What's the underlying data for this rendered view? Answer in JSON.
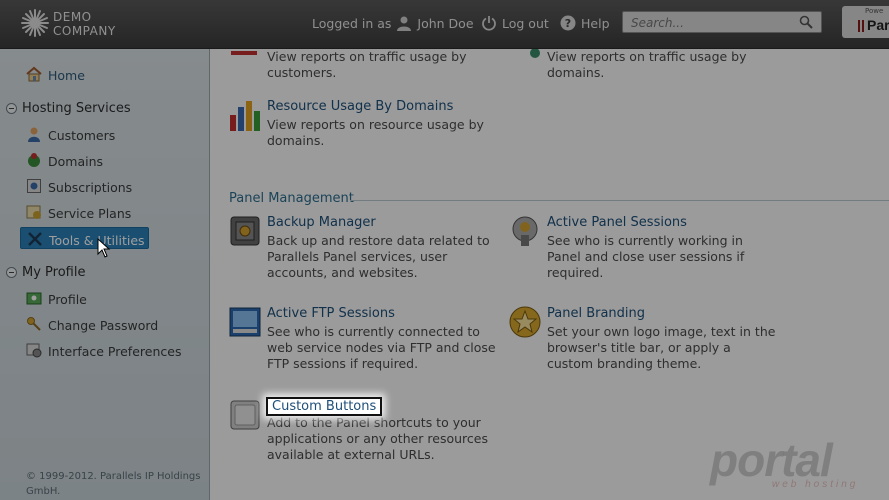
{
  "header": {
    "logo_line1": "DEMO",
    "logo_line2": "COMPANY",
    "logged_in_as": "Logged in as",
    "user_name": "John Doe",
    "logout": "Log out",
    "help": "Help",
    "search_placeholder": "Search...",
    "brand_small": "Powe",
    "brand_name": "Par"
  },
  "sidebar": {
    "home": "Home",
    "hosting_services": "Hosting Services",
    "customers": "Customers",
    "domains": "Domains",
    "subscriptions": "Subscriptions",
    "service_plans": "Service Plans",
    "tools_utilities": "Tools & Utilities",
    "my_profile": "My Profile",
    "profile": "Profile",
    "change_password": "Change Password",
    "interface_preferences": "Interface Preferences",
    "footer": "© 1999-2012. Parallels IP Holdings GmbH."
  },
  "main": {
    "top_left_desc": "View reports on traffic usage by customers.",
    "top_right_desc": "View reports on traffic usage by domains.",
    "resource_usage": {
      "title": "Resource Usage By Domains",
      "desc": "View reports on resource usage by domains."
    },
    "panel_management": "Panel Management",
    "backup_manager": {
      "title": "Backup Manager",
      "desc": "Back up and restore data related to Parallels Panel services, user accounts, and websites."
    },
    "active_panel_sessions": {
      "title": "Active Panel Sessions",
      "desc": "See who is currently working in Panel and close user sessions if required."
    },
    "active_ftp_sessions": {
      "title": "Active FTP Sessions",
      "desc": "See who is currently connected to web service nodes via FTP and close FTP sessions if required."
    },
    "panel_branding": {
      "title": "Panel Branding",
      "desc": "Set your own logo image, text in the browser's title bar, or apply a custom branding theme."
    },
    "custom_buttons": {
      "title": "Custom Buttons",
      "desc": "Add to the Panel shortcuts to your applications or any other resources available at external URLs."
    }
  },
  "watermark": {
    "line1": "portal",
    "line2": "web hosting"
  },
  "colors": {
    "active_nav": "#2a80b9",
    "link": "#1d4f79",
    "section": "#2c6e8f"
  }
}
